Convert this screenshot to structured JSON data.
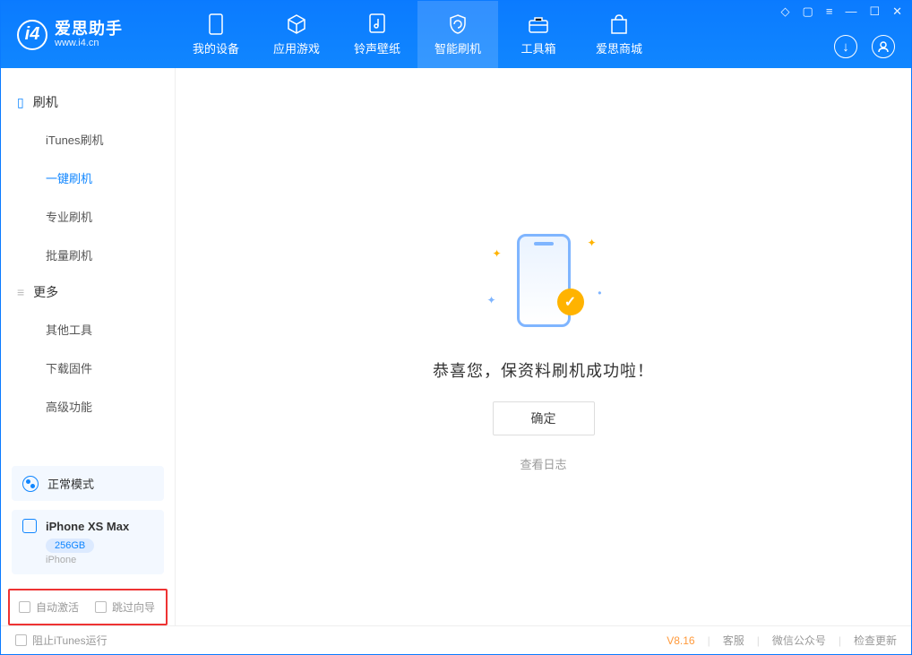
{
  "app": {
    "name_cn": "爱思助手",
    "name_en": "www.i4.cn"
  },
  "nav": {
    "items": [
      {
        "label": "我的设备",
        "icon": "device"
      },
      {
        "label": "应用游戏",
        "icon": "cube"
      },
      {
        "label": "铃声壁纸",
        "icon": "music"
      },
      {
        "label": "智能刷机",
        "icon": "refresh",
        "active": true
      },
      {
        "label": "工具箱",
        "icon": "toolbox"
      },
      {
        "label": "爱思商城",
        "icon": "bag"
      }
    ]
  },
  "sidebar": {
    "section1_title": "刷机",
    "section1_items": [
      "iTunes刷机",
      "一键刷机",
      "专业刷机",
      "批量刷机"
    ],
    "section1_active_index": 1,
    "section2_title": "更多",
    "section2_items": [
      "其他工具",
      "下载固件",
      "高级功能"
    ]
  },
  "mode_box": {
    "label": "正常模式"
  },
  "device_box": {
    "name": "iPhone XS Max",
    "capacity": "256GB",
    "type": "iPhone"
  },
  "highlight_checks": {
    "auto_activate": "自动激活",
    "skip_guide": "跳过向导"
  },
  "main": {
    "success_text": "恭喜您，保资料刷机成功啦！",
    "ok_button": "确定",
    "view_log": "查看日志"
  },
  "footer": {
    "block_itunes": "阻止iTunes运行",
    "version": "V8.16",
    "links": [
      "客服",
      "微信公众号",
      "检查更新"
    ]
  }
}
